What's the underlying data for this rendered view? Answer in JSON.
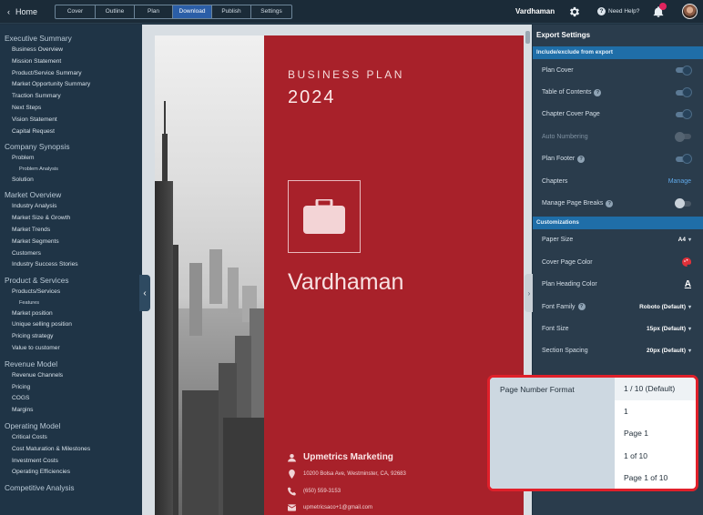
{
  "topbar": {
    "home_label": "Home",
    "tabs": [
      {
        "label": "Cover"
      },
      {
        "label": "Outline"
      },
      {
        "label": "Plan"
      },
      {
        "label": "Download"
      },
      {
        "label": "Publish"
      },
      {
        "label": "Settings"
      }
    ],
    "active_tab": "Download",
    "company_name": "Vardhaman",
    "help_label": "Need Help?"
  },
  "sidebar": {
    "sections": [
      {
        "title": "Executive Summary",
        "items": [
          "Business Overview",
          "Mission Statement",
          "Product/Service Summary",
          "Market Opportunity Summary",
          "Traction Summary",
          "Next Steps",
          "Vision Statement",
          "Capital Request"
        ]
      },
      {
        "title": "Company Synopsis",
        "items": [
          "Problem",
          "Problem Analysis",
          "Solution"
        ]
      },
      {
        "title": "Market Overview",
        "items": [
          "Industry Analysis",
          "Market Size & Growth",
          "Market Trends",
          "Market Segments",
          "Customers",
          "Industry Success Stories"
        ]
      },
      {
        "title": "Product & Services",
        "items": [
          "Products/Services",
          "Features",
          "Market position",
          "Unique selling position",
          "Pricing strategy",
          "Value to customer"
        ]
      },
      {
        "title": "Revenue Model",
        "items": [
          "Revenue Channels",
          "Pricing",
          "COGS",
          "Margins"
        ]
      },
      {
        "title": "Operating Model",
        "items": [
          "Critical Costs",
          "Cost Maturation & Milestones",
          "Investment Costs",
          "Operating Efficiencies"
        ]
      },
      {
        "title": "Competitive Analysis",
        "items": []
      }
    ]
  },
  "cover": {
    "heading": "BUSINESS PLAN",
    "year": "2024",
    "company": "Vardhaman",
    "contact_name": "Upmetrics Marketing",
    "address": "10200 Bolsa Ave, Westminster, CA, 92683",
    "phone": "(650) 559-3153",
    "email": "upmetricsaco+1@gmail.com"
  },
  "panel": {
    "title": "Export Settings",
    "include_band": "Include/exclude from export",
    "toggles": [
      {
        "label": "Plan Cover",
        "on": true,
        "info": false
      },
      {
        "label": "Table of Contents",
        "on": true,
        "info": true
      },
      {
        "label": "Chapter Cover Page",
        "on": true,
        "info": false
      },
      {
        "label": "Auto Numbering",
        "on": false,
        "info": false,
        "disabled": true
      },
      {
        "label": "Plan Footer",
        "on": true,
        "info": true
      }
    ],
    "chapters_label": "Chapters",
    "chapters_link": "Manage",
    "page_breaks_label": "Manage Page Breaks",
    "custom_band": "Customizations",
    "paper_size_label": "Paper Size",
    "paper_size_value": "A4",
    "cover_color_label": "Cover Page Color",
    "heading_color_label": "Plan Heading Color",
    "font_family_label": "Font Family",
    "font_family_value": "Roboto (Default)",
    "font_size_label": "Font Size",
    "font_size_value": "15px (Default)",
    "section_spacing_label": "Section Spacing",
    "section_spacing_value": "20px (Default)"
  },
  "popup": {
    "label": "Page Number Format",
    "options": [
      "1 / 10 (Default)",
      "1",
      "Page 1",
      "1 of 10",
      "Page 1 of 10"
    ]
  },
  "colors": {
    "accent": "#1f6ea8",
    "cover_red": "#a8212a",
    "highlight": "#e0202a"
  }
}
